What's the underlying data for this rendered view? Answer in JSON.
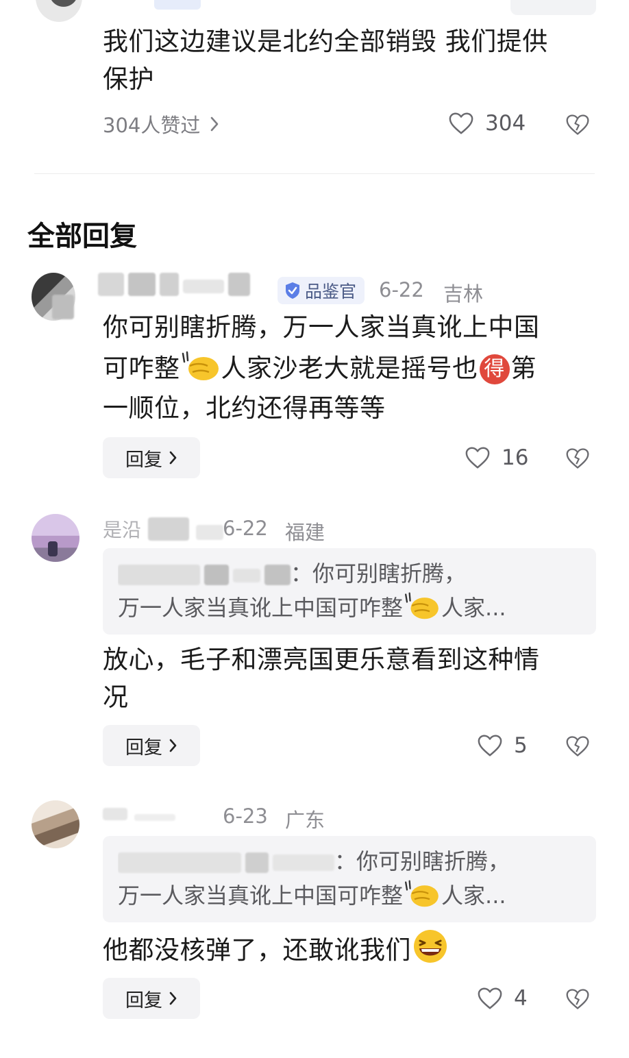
{
  "top_comment": {
    "text_line1": "我们这边建议是北约全部销毁 我们提供",
    "text_line2": "保护",
    "likers_label": "304人赞过",
    "like_count": "304"
  },
  "section_title": "全部回复",
  "replies": [
    {
      "badge": "品鉴官",
      "date": "6-22",
      "location": "吉林",
      "text_line1": "你可别瞎折腾，万一人家当真讹上中国",
      "text_line2a": "可咋整",
      "text_line2b": "人家沙老大就是摇号也",
      "text_line2_glyph": "得",
      "text_line2c": "第",
      "text_line3": "一顺位，北约还得再等等",
      "reply_label": "回复",
      "like_count": "16"
    },
    {
      "name_partial": "是沿",
      "date": "6-22",
      "location": "福建",
      "quote_line1": "：你可别瞎折腾，",
      "quote_line2a": "万一人家当真讹上中国可咋整",
      "quote_line2b": "人家...",
      "text_line1": "放心，毛子和漂亮国更乐意看到这种情",
      "text_line2": "况",
      "reply_label": "回复",
      "like_count": "5"
    },
    {
      "date": "6-23",
      "location": "广东",
      "quote_line1": "：你可别瞎折腾，",
      "quote_line2a": "万一人家当真讹上中国可咋整",
      "quote_line2b": "人家...",
      "text_line1": "他都没核弹了，还敢讹我们",
      "reply_label": "回复",
      "like_count": "4"
    }
  ],
  "colors": {
    "badge_bg": "#eef1fb",
    "badge_icon": "#5b7ee6",
    "emoji_yellow": "#f7c52b",
    "glyph_red": "#e0483c"
  },
  "icons": [
    "heart-outline-icon",
    "broken-heart-icon",
    "chevron-right-icon",
    "verified-shield-icon",
    "pointing-hand-emoji",
    "laughing-face-emoji"
  ]
}
